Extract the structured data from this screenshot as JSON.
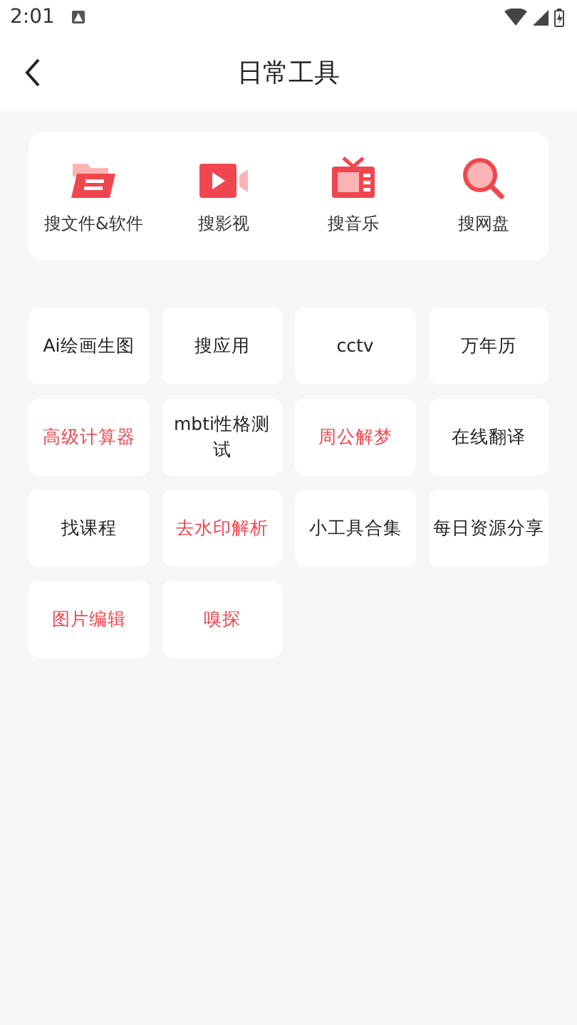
{
  "status_bar": {
    "time": "2:01"
  },
  "header": {
    "title": "日常工具"
  },
  "search_sources": [
    {
      "kind": "folder",
      "label": "搜文件&软件"
    },
    {
      "kind": "video",
      "label": "搜影视"
    },
    {
      "kind": "tv",
      "label": "搜音乐"
    },
    {
      "kind": "search",
      "label": "搜网盘"
    }
  ],
  "tools": [
    {
      "label": "Ai绘画生图",
      "highlighted": false
    },
    {
      "label": "搜应用",
      "highlighted": false
    },
    {
      "label": "cctv",
      "highlighted": false
    },
    {
      "label": "万年历",
      "highlighted": false
    },
    {
      "label": "高级计算器",
      "highlighted": true
    },
    {
      "label": "mbti性格测试",
      "highlighted": false
    },
    {
      "label": "周公解梦",
      "highlighted": true
    },
    {
      "label": "在线翻译",
      "highlighted": false
    },
    {
      "label": "找课程",
      "highlighted": false
    },
    {
      "label": "去水印解析",
      "highlighted": true
    },
    {
      "label": "小工具合集",
      "highlighted": false
    },
    {
      "label": "每日资源分享",
      "highlighted": false
    },
    {
      "label": "图片编辑",
      "highlighted": true
    },
    {
      "label": "嗅探",
      "highlighted": true
    }
  ]
}
